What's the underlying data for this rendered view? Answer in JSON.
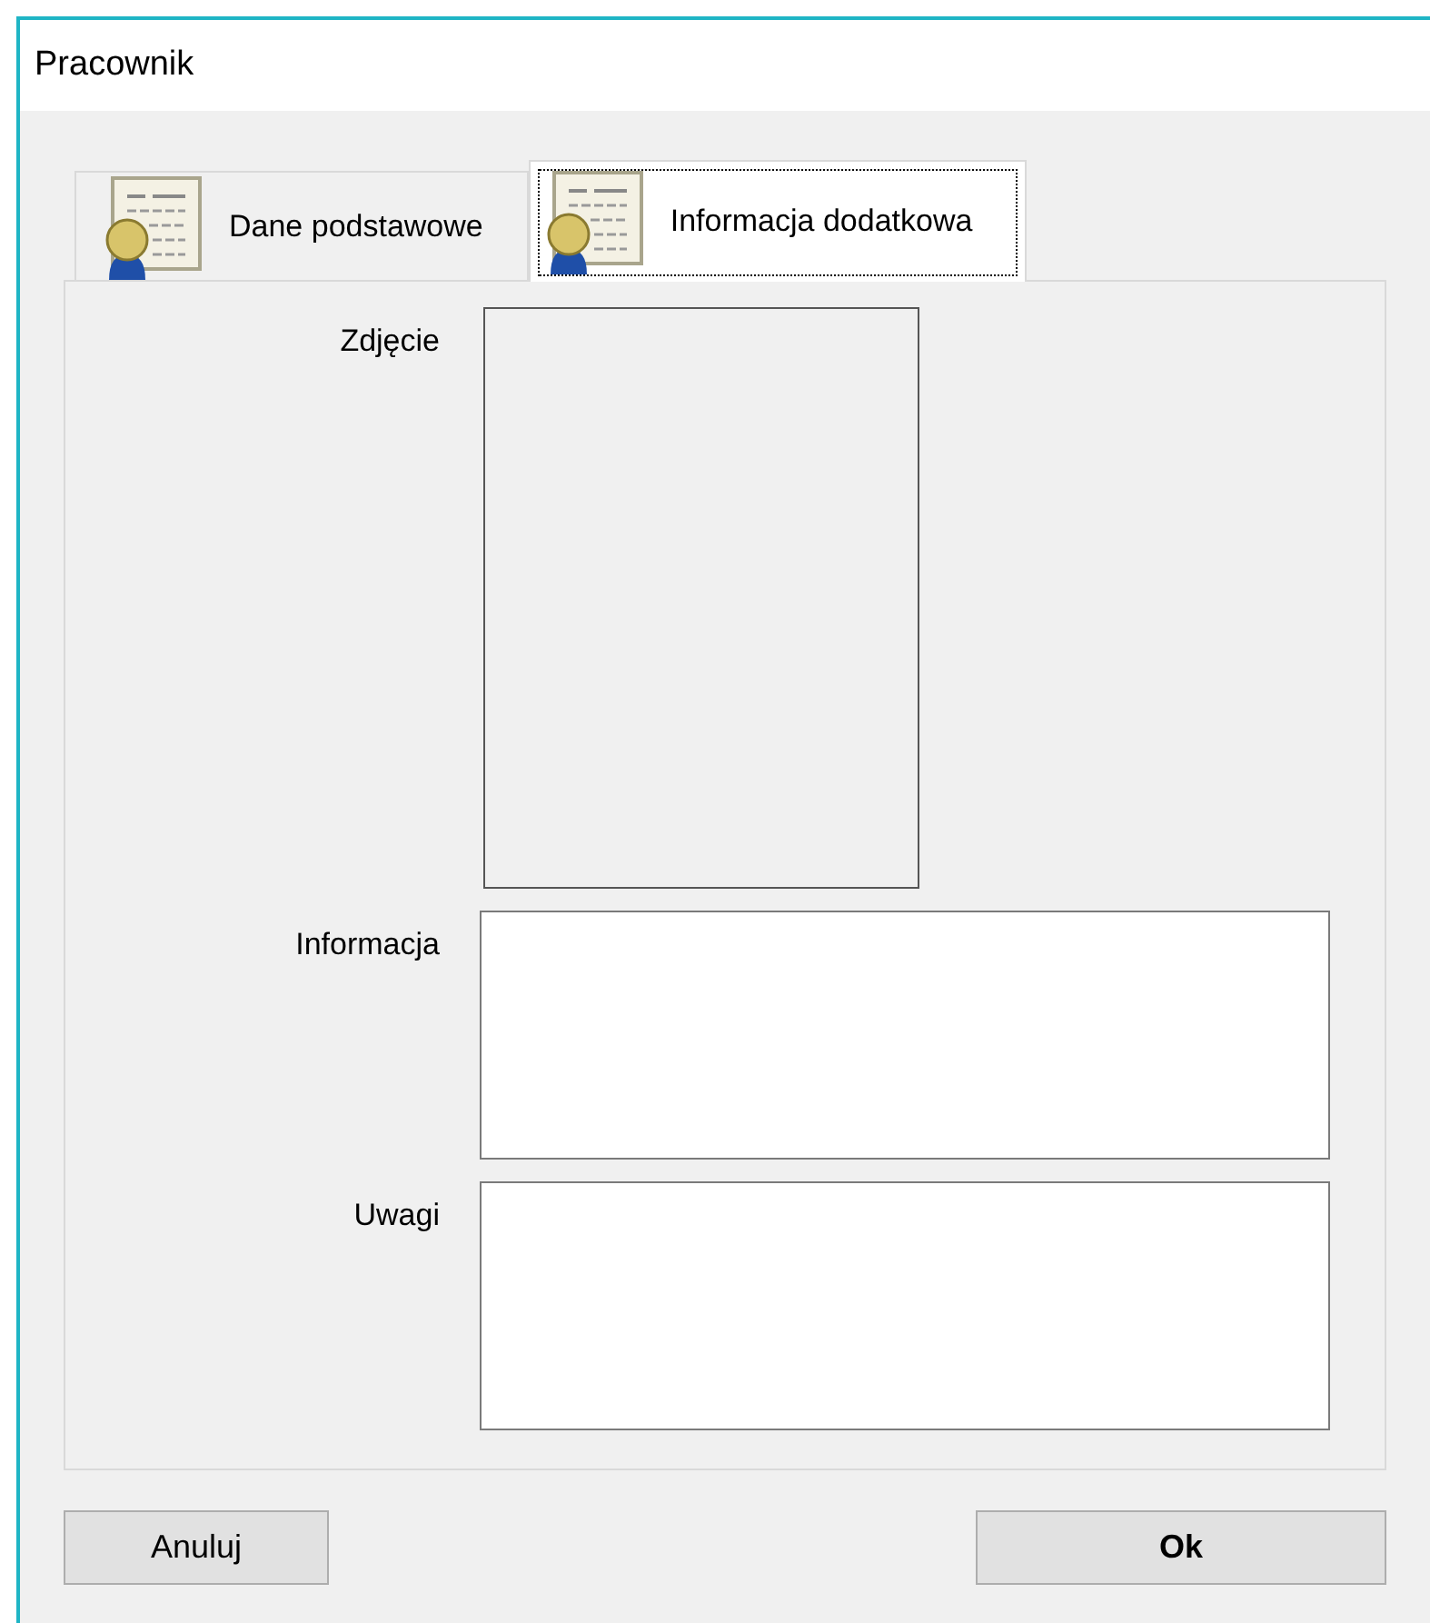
{
  "window": {
    "title": "Pracownik"
  },
  "tabs": [
    {
      "label": "Dane podstawowe",
      "selected": false
    },
    {
      "label": "Informacja dodatkowa",
      "selected": true
    }
  ],
  "fields": [
    {
      "label": "Zdjęcie",
      "kind": "photo"
    },
    {
      "label": "Informacja",
      "kind": "textarea"
    },
    {
      "label": "Uwagi",
      "kind": "textarea"
    }
  ],
  "buttons": [
    {
      "label": "Anuluj",
      "default": false
    },
    {
      "label": "Ok",
      "default": true
    }
  ]
}
